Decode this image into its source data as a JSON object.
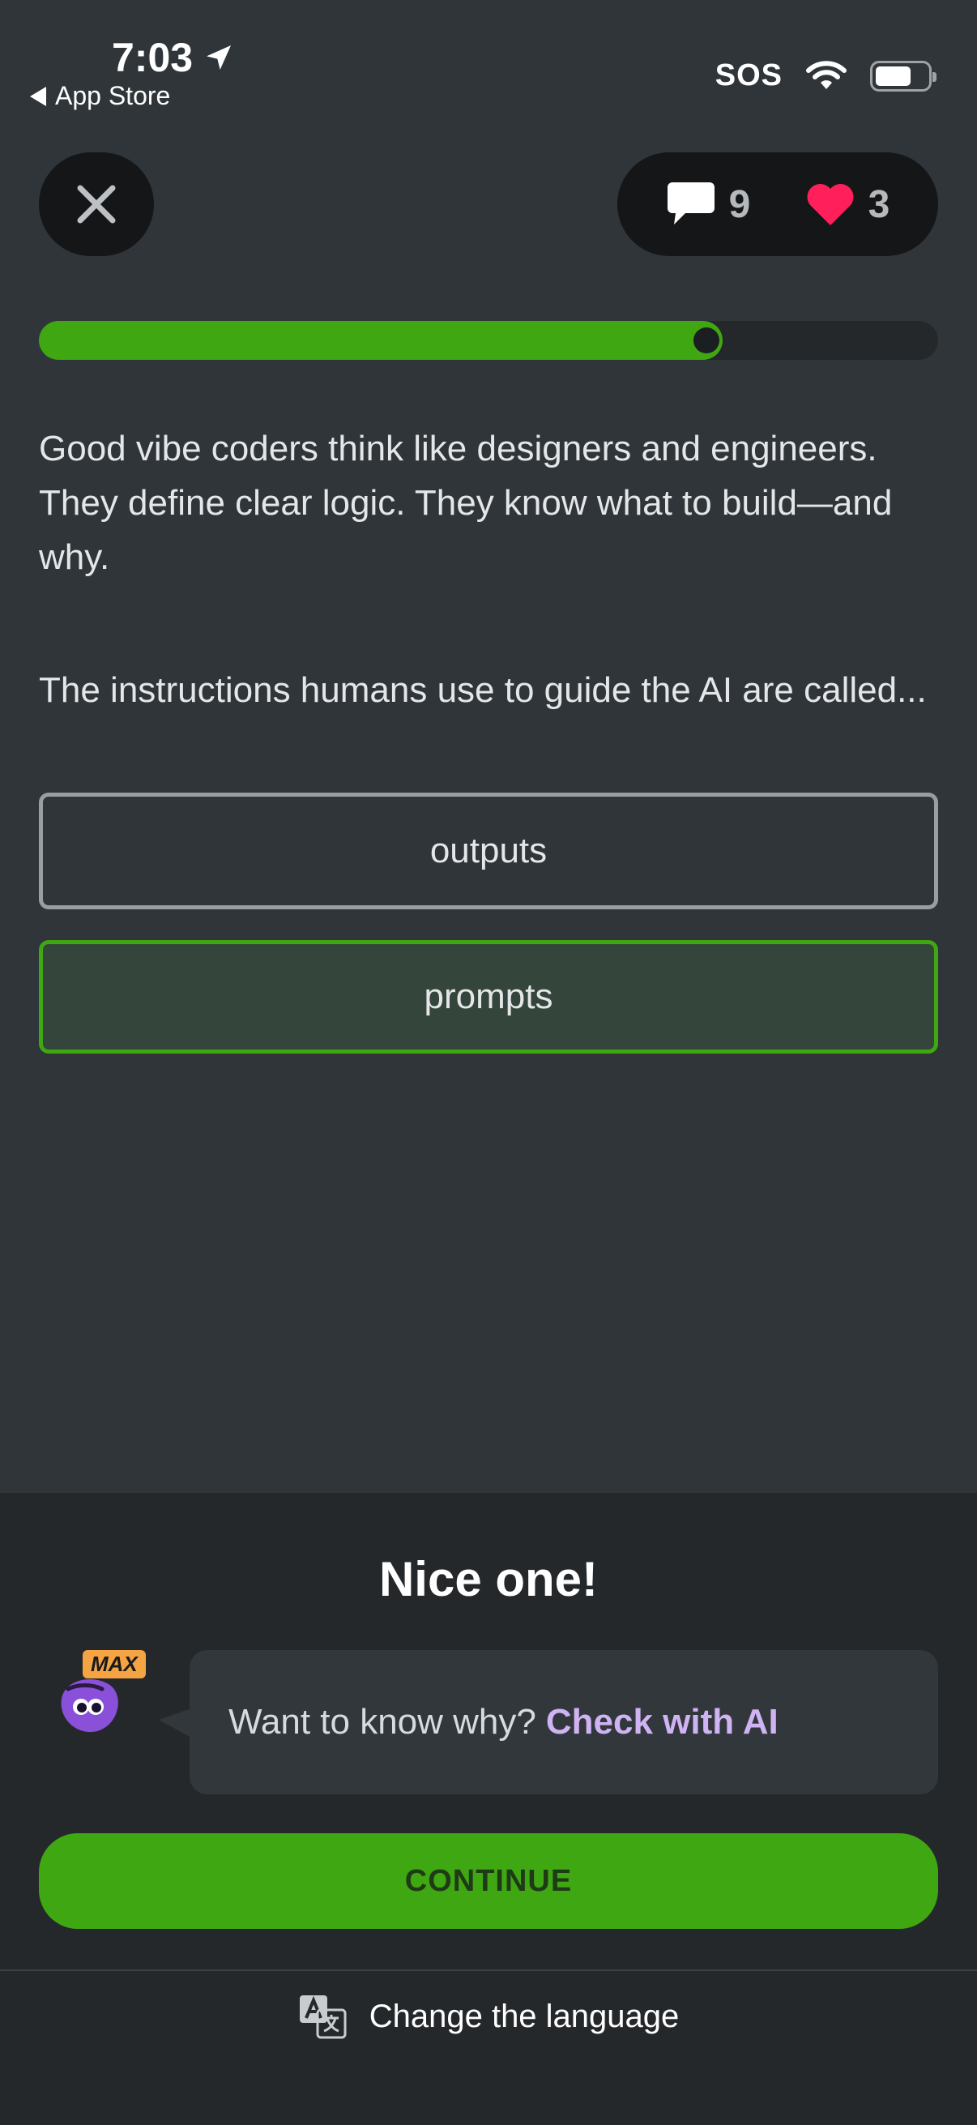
{
  "status_bar": {
    "time": "7:03",
    "back_label": "App Store",
    "sos": "SOS"
  },
  "header": {
    "comments_count": "9",
    "hearts_count": "3"
  },
  "progress": {
    "value_percent": 76
  },
  "lesson": {
    "text": "Good vibe coders think like designers and engineers. They define clear logic. They know what to build—and why.",
    "question": "The instructions humans use to guide the AI are called..."
  },
  "options": [
    {
      "label": "outputs",
      "state": "default"
    },
    {
      "label": "prompts",
      "state": "correct"
    }
  ],
  "feedback": {
    "title": "Nice one!",
    "badge": "MAX",
    "prompt": "Want to know why?",
    "link": "Check with AI",
    "continue_label": "CONTINUE",
    "language_label": "Change the language"
  },
  "colors": {
    "accent_green": "#3fa711",
    "heart_red": "#ff1f5a",
    "link_purple": "#cfb3f2",
    "badge_orange": "#f5a443"
  },
  "icons": [
    "location-arrow-icon",
    "back-caret-icon",
    "wifi-icon",
    "battery-icon",
    "close-icon",
    "comment-icon",
    "heart-icon",
    "avatar-icon",
    "translate-icon"
  ]
}
